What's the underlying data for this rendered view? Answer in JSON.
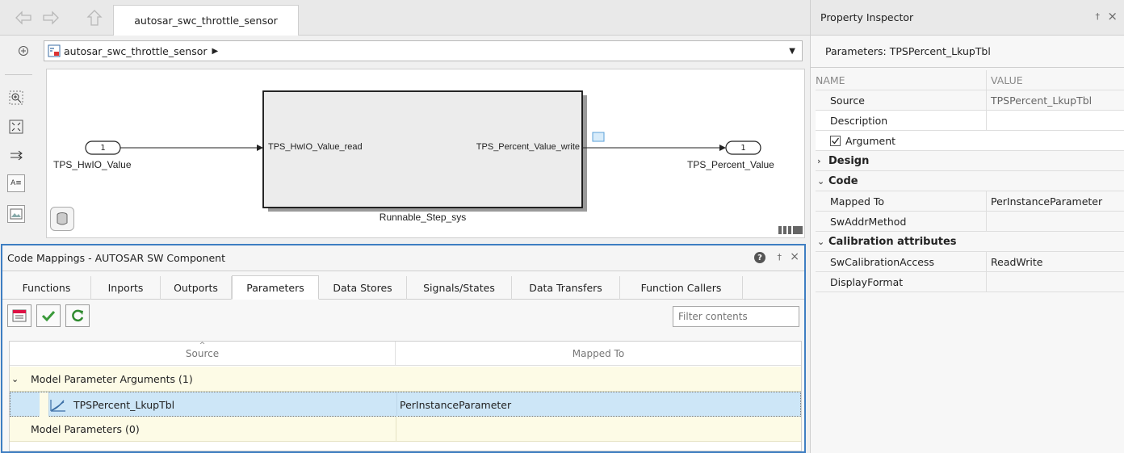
{
  "nav": {
    "back_icon": "back-arrow-icon",
    "forward_icon": "forward-arrow-icon",
    "up_icon": "up-arrow-icon",
    "tab_title": "autosar_swc_throttle_sensor"
  },
  "address": {
    "path": "autosar_swc_throttle_sensor"
  },
  "canvas": {
    "inport_number": "1",
    "inport_label": "TPS_HwIO_Value",
    "outport_number": "1",
    "outport_label": "TPS_Percent_Value",
    "subsystem_in_label": "TPS_HwIO_Value_read",
    "subsystem_out_label": "TPS_Percent_Value_write",
    "subsystem_name": "Runnable_Step_sys"
  },
  "code_mappings": {
    "title": "Code Mappings - AUTOSAR SW Component",
    "tabs": [
      "Functions",
      "Inports",
      "Outports",
      "Parameters",
      "Data Stores",
      "Signals/States",
      "Data Transfers",
      "Function Callers"
    ],
    "active_tab": "Parameters",
    "filter_placeholder": "Filter contents",
    "columns": {
      "source": "Source",
      "mapped_to": "Mapped To"
    },
    "groups": [
      {
        "label": "Model Parameter Arguments (1)"
      },
      {
        "label": "Model Parameters (0)"
      }
    ],
    "rows": [
      {
        "source": "TPSPercent_LkupTbl",
        "mapped_to": "PerInstanceParameter"
      }
    ]
  },
  "property_inspector": {
    "title": "Property Inspector",
    "subtitle": "Parameters: TPSPercent_LkupTbl",
    "header_name": "NAME",
    "header_value": "VALUE",
    "rows": [
      {
        "name": "Source",
        "value": "TPSPercent_LkupTbl"
      },
      {
        "name": "Description",
        "value": ""
      },
      {
        "name": "Argument",
        "value": ""
      },
      {
        "name": "Design",
        "value": ""
      },
      {
        "name": "Code",
        "value": ""
      },
      {
        "name": "Mapped To",
        "value": "PerInstanceParameter"
      },
      {
        "name": "SwAddrMethod",
        "value": ""
      },
      {
        "name": "Calibration attributes",
        "value": ""
      },
      {
        "name": "SwCalibrationAccess",
        "value": "ReadWrite"
      },
      {
        "name": "DisplayFormat",
        "value": ""
      }
    ]
  },
  "colors": {
    "accent_border": "#3e7ec2",
    "selected_row": "#cde6f7",
    "group_row": "#fdfbe6"
  }
}
